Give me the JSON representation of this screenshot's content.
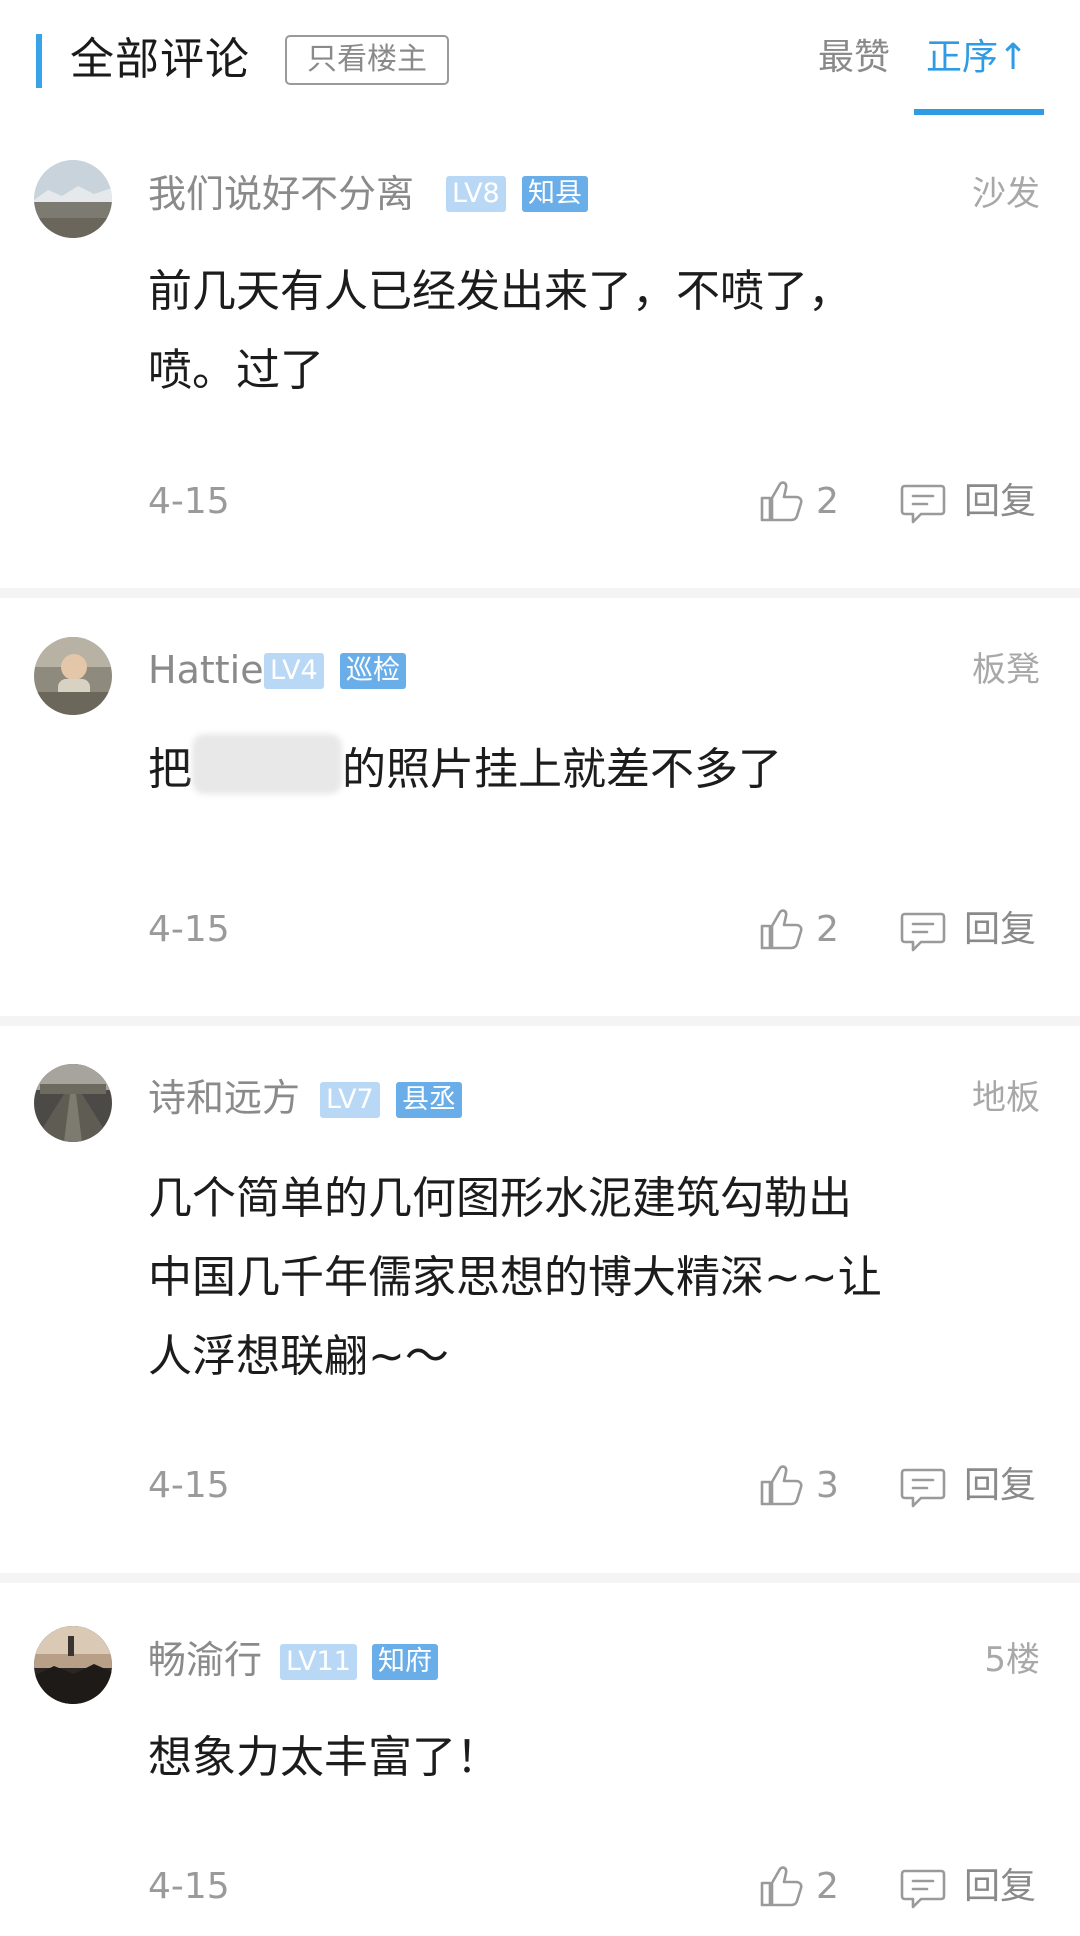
{
  "header": {
    "title": "全部评论",
    "owner_only_label": "只看楼主",
    "sort_hot_label": "最赞",
    "sort_asc_label": "正序↑"
  },
  "comments": [
    {
      "username": "我们说好不分离",
      "level": "LV8",
      "title_badge": "知县",
      "floor": "沙发",
      "content_lines": [
        "前几天有人已经发出来了，不喷了，",
        "喷。过了"
      ],
      "date": "4-15",
      "likes": "2",
      "reply_label": "回复",
      "avatar_icon": "landscape-avatar-icon"
    },
    {
      "username": "Hattie",
      "level": "LV4",
      "title_badge": "巡检",
      "floor": "板凳",
      "content_prefix": "把",
      "content_suffix": "的照片挂上就差不多了",
      "date": "4-15",
      "likes": "2",
      "reply_label": "回复",
      "avatar_icon": "child-avatar-icon"
    },
    {
      "username": "诗和远方",
      "level": "LV7",
      "title_badge": "县丞",
      "floor": "地板",
      "content_lines": [
        "几个简单的几何图形水泥建筑勾勒出",
        "中国几千年儒家思想的博大精深~~让",
        "人浮想联翩~～"
      ],
      "date": "4-15",
      "likes": "3",
      "reply_label": "回复",
      "avatar_icon": "road-avatar-icon"
    },
    {
      "username": "畅渝行",
      "level": "LV11",
      "title_badge": "知府",
      "floor": "5楼",
      "content_lines": [
        "想象力太丰富了！"
      ],
      "date": "4-15",
      "likes": "2",
      "reply_label": "回复",
      "avatar_icon": "sunset-avatar-icon"
    }
  ],
  "colors": {
    "accent": "#2f9be3",
    "level_badge": "#b9d8f5",
    "title_badge": "#6aaee9",
    "muted_text": "#8a8a8a"
  }
}
